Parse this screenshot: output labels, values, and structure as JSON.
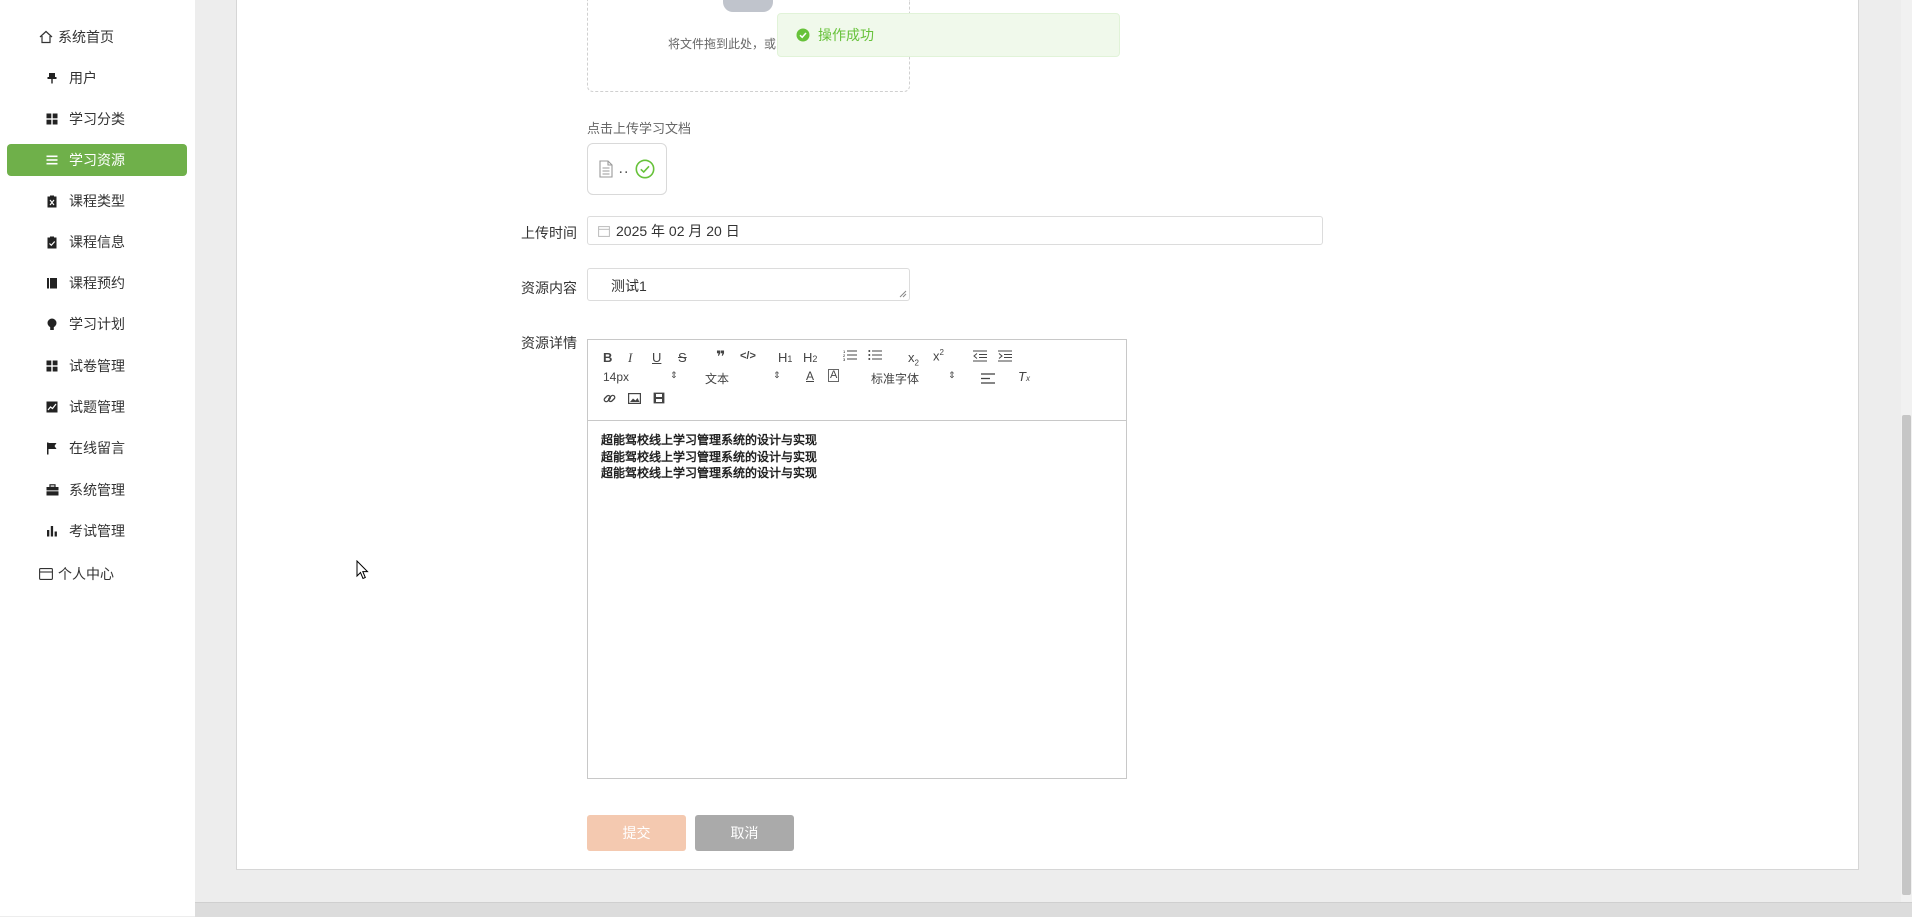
{
  "sidebar": {
    "home": "系统首页",
    "items": [
      {
        "label": "用户",
        "icon": "pin-icon"
      },
      {
        "label": "学习分类",
        "icon": "grid-icon"
      },
      {
        "label": "学习资源",
        "icon": "list-icon"
      },
      {
        "label": "课程类型",
        "icon": "clipboard-icon"
      },
      {
        "label": "课程信息",
        "icon": "clipboard-check-icon"
      },
      {
        "label": "课程预约",
        "icon": "book-icon"
      },
      {
        "label": "学习计划",
        "icon": "bulb-icon"
      },
      {
        "label": "试卷管理",
        "icon": "grid-icon"
      },
      {
        "label": "试题管理",
        "icon": "chart-icon"
      },
      {
        "label": "在线留言",
        "icon": "flag-icon"
      },
      {
        "label": "系统管理",
        "icon": "briefcase-icon"
      },
      {
        "label": "考试管理",
        "icon": "bar-chart-icon"
      }
    ],
    "personal": "个人中心",
    "active_color": "#6fb04a"
  },
  "upload": {
    "hint": "将文件拖到此处，或",
    "doc_label": "点击上传学习文档",
    "file_name": ".."
  },
  "toast": {
    "text": "操作成功",
    "color": "#67c23a"
  },
  "form": {
    "upload_time_label": "上传时间",
    "upload_time_value": "2025 年 02 月 20 日",
    "content_label": "资源内容",
    "content_value": "测试1",
    "detail_label": "资源详情"
  },
  "editor": {
    "font_size": "14px",
    "format": "文本",
    "font_family": "标准字体",
    "lines": [
      "超能驾校线上学习管理系统的设计与实现",
      "超能驾校线上学习管理系统的设计与实现",
      "超能驾校线上学习管理系统的设计与实现"
    ]
  },
  "buttons": {
    "submit": "提交",
    "cancel": "取消",
    "submit_color": "#f4c9b0",
    "cancel_color": "#aaaaaa"
  }
}
